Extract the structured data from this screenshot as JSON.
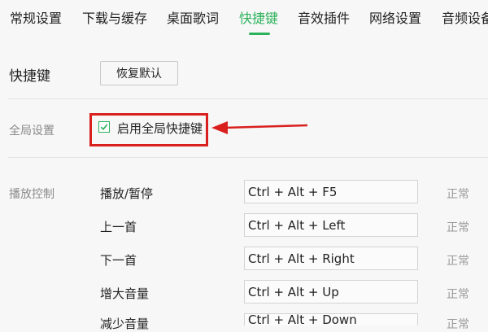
{
  "tabs": [
    {
      "label": "常规设置"
    },
    {
      "label": "下载与缓存"
    },
    {
      "label": "桌面歌词"
    },
    {
      "label": "快捷键"
    },
    {
      "label": "音效插件"
    },
    {
      "label": "网络设置"
    },
    {
      "label": "音频设备"
    }
  ],
  "active_tab_index": 3,
  "shortcuts_section": {
    "title": "快捷键",
    "restore_default_label": "恢复默认"
  },
  "global_settings": {
    "label": "全局设置",
    "enable_global_checkbox_label": "启用全局快捷键",
    "enable_global_checked": true
  },
  "playback_control": {
    "label": "播放控制",
    "rows": [
      {
        "action": "播放/暂停",
        "keys": "Ctrl + Alt + F5",
        "status": "正常"
      },
      {
        "action": "上一首",
        "keys": "Ctrl + Alt + Left",
        "status": "正常"
      },
      {
        "action": "下一首",
        "keys": "Ctrl + Alt + Right",
        "status": "正常"
      },
      {
        "action": "增大音量",
        "keys": "Ctrl + Alt + Up",
        "status": "正常"
      },
      {
        "action": "减少音量",
        "keys": "Ctrl + Alt + Down",
        "status": "正常"
      }
    ]
  },
  "colors": {
    "accent": "#2cb25a",
    "annotation_red": "#d9201f",
    "background": "#f7f7f7"
  }
}
